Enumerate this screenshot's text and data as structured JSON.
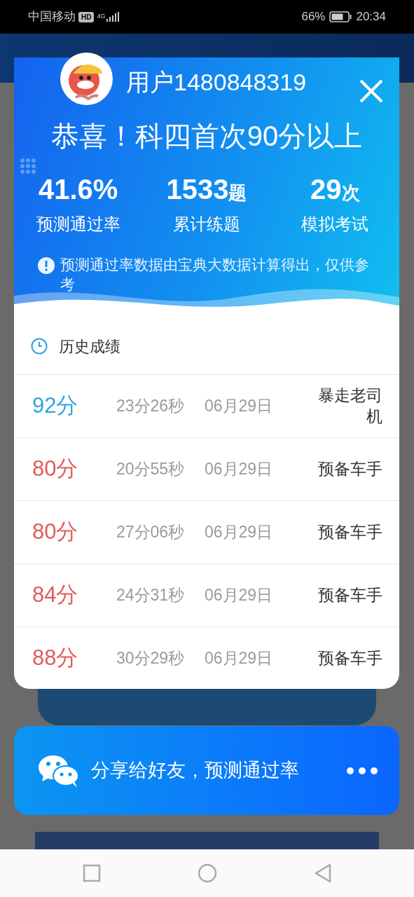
{
  "status_bar": {
    "carrier": "中国移动",
    "hd": "HD",
    "network": "4G",
    "battery": "66%",
    "time": "20:34"
  },
  "dialog": {
    "username": "用户1480848319",
    "headline": "恭喜！科四首次90分以上",
    "stats": [
      {
        "value": "41.6%",
        "label": "预测通过率"
      },
      {
        "value": "1533",
        "unit": "题",
        "label": "累计练题"
      },
      {
        "value": "29",
        "unit": "次",
        "label": "模拟考试"
      }
    ],
    "note": "预测通过率数据由宝典大数据计算得出，仅供参考",
    "history_title": "历史成绩",
    "history": [
      {
        "score": "92分",
        "color": "#33a3dc",
        "duration": "23分26秒",
        "date": "06月29日",
        "rank": "暴走老司机"
      },
      {
        "score": "80分",
        "color": "#e25a5a",
        "duration": "20分55秒",
        "date": "06月29日",
        "rank": "预备车手"
      },
      {
        "score": "80分",
        "color": "#e25a5a",
        "duration": "27分06秒",
        "date": "06月29日",
        "rank": "预备车手"
      },
      {
        "score": "84分",
        "color": "#e25a5a",
        "duration": "24分31秒",
        "date": "06月29日",
        "rank": "预备车手"
      },
      {
        "score": "88分",
        "color": "#e25a5a",
        "duration": "30分29秒",
        "date": "06月29日",
        "rank": "预备车手"
      }
    ]
  },
  "share_bar": {
    "label": "分享给好友，预测通过率"
  }
}
